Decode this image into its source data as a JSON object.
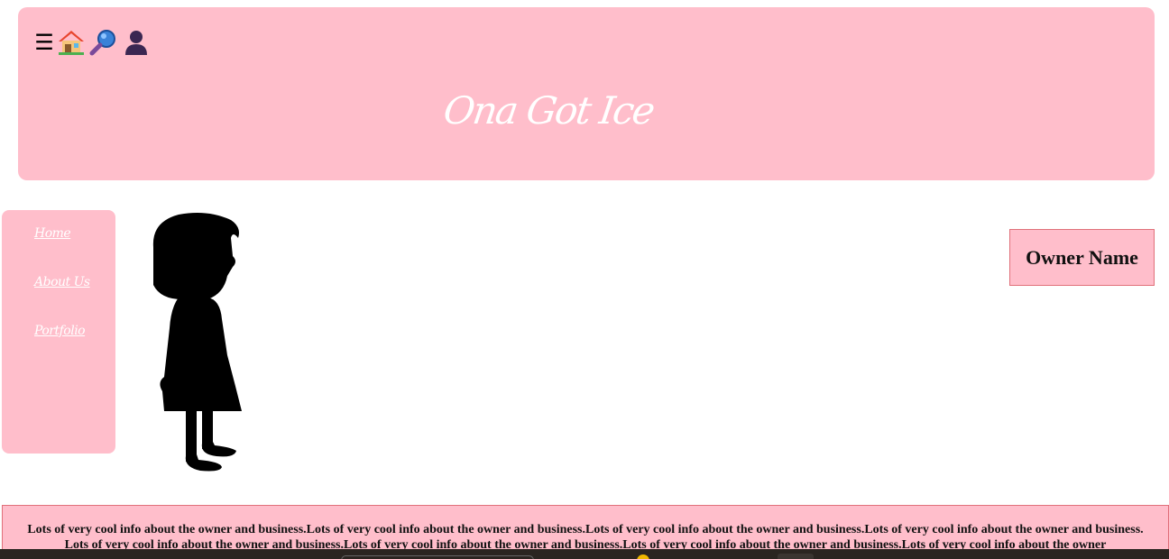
{
  "header": {
    "title": "Ona Got Ice",
    "icons": [
      "menu-icon",
      "home-icon",
      "search-icon",
      "user-icon"
    ],
    "menu_glyph": "☰"
  },
  "sidebar": {
    "items": [
      {
        "label": "Home"
      },
      {
        "label": "About Us"
      },
      {
        "label": "Portfolio"
      }
    ]
  },
  "owner": {
    "name": "Owner Name"
  },
  "info": {
    "text": "Lots of very cool info about the owner and business.Lots of very cool info about the owner and business.Lots of very cool info about the owner and business.Lots of very cool info about the owner and business. Lots of very cool info about the owner and business.Lots of very cool info about the owner and business.Lots of very cool info about the owner and business.Lots of very cool info about the owner"
  },
  "colors": {
    "accent_pink": "#ffbecb",
    "border_pink": "#e0707a",
    "text_white": "#ffffff"
  }
}
